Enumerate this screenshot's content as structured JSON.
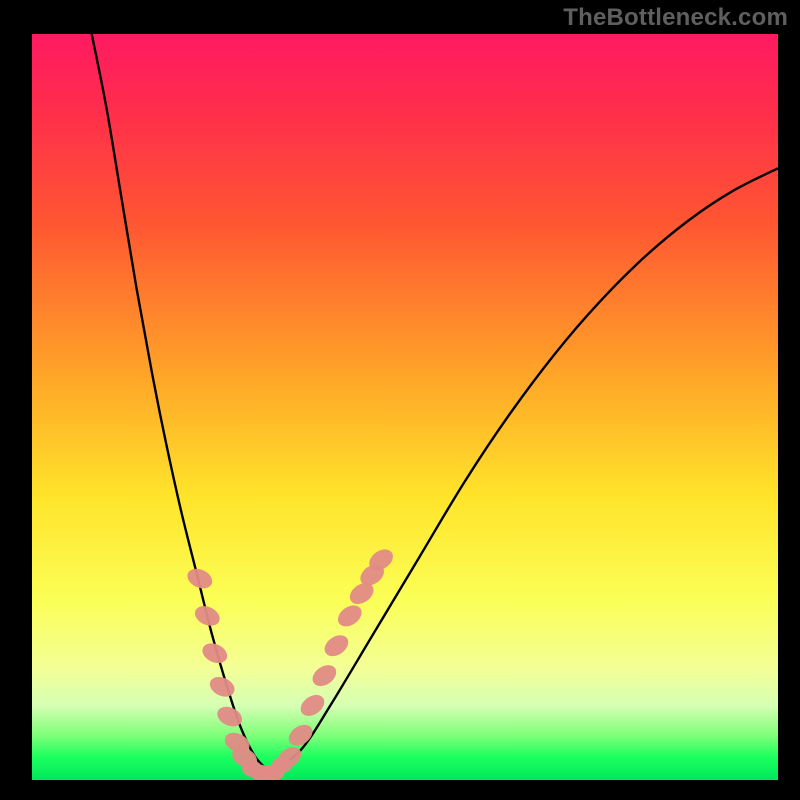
{
  "watermark": "TheBottleneck.com",
  "chart_data": {
    "type": "line",
    "title": "",
    "xlabel": "",
    "ylabel": "",
    "xlim": [
      0,
      100
    ],
    "ylim": [
      0,
      100
    ],
    "notes": "Bottleneck curve: black V-shaped curve over a vertical color gradient (red=high bottleneck at top, green=low at bottom). X-axis represents component rating (a.u.), Y-axis represents bottleneck percentage. Pink dotted markers highlight the balanced region near the valley. No numeric axis ticks are shown in the image.",
    "series": [
      {
        "name": "bottleneck-curve-left",
        "x": [
          8,
          10,
          12,
          14,
          16,
          18,
          20,
          22,
          24,
          26,
          28,
          30,
          32
        ],
        "values": [
          100,
          90,
          78,
          66,
          55,
          45,
          36,
          28,
          20,
          13,
          7,
          3,
          1
        ]
      },
      {
        "name": "bottleneck-curve-right",
        "x": [
          32,
          36,
          40,
          46,
          52,
          58,
          64,
          70,
          76,
          82,
          88,
          94,
          100
        ],
        "values": [
          1,
          4,
          10,
          20,
          30,
          40,
          49,
          57,
          64,
          70,
          75,
          79,
          82
        ]
      },
      {
        "name": "balanced-markers-left",
        "x": [
          22.5,
          23.5,
          24.5,
          25.5,
          26.5,
          27.5,
          28.5
        ],
        "values": [
          27,
          22,
          17,
          12.5,
          8.5,
          5,
          3
        ]
      },
      {
        "name": "balanced-markers-right",
        "x": [
          34.5,
          36,
          37.6,
          39.2,
          40.8,
          42.6,
          44.2,
          45.6,
          46.8
        ],
        "values": [
          3,
          6,
          10,
          14,
          18,
          22,
          25,
          27.5,
          29.5
        ]
      },
      {
        "name": "balanced-markers-bottom",
        "x": [
          29.5,
          30.5,
          31.5,
          32.5,
          33.5
        ],
        "values": [
          1.5,
          1,
          0.8,
          1,
          2
        ]
      }
    ]
  }
}
